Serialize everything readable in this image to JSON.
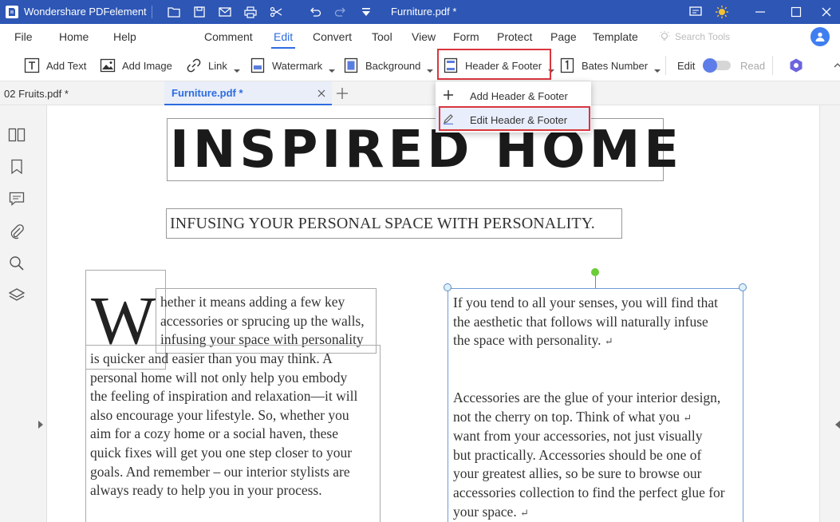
{
  "titlebar": {
    "app_name": "Wondershare PDFelement",
    "document_title": "Furniture.pdf *",
    "bg_color": "#2d56b5"
  },
  "menubar": {
    "items": [
      "File",
      "Home",
      "Help",
      "Comment",
      "Edit",
      "Convert",
      "Tool",
      "View",
      "Form",
      "Protect",
      "Page",
      "Template"
    ],
    "active": "Edit",
    "search_placeholder": "Search Tools"
  },
  "toolbar": {
    "add_text": "Add Text",
    "add_image": "Add Image",
    "link": "Link",
    "watermark": "Watermark",
    "background": "Background",
    "header_footer": "Header & Footer",
    "bates_number": "Bates Number",
    "edit": "Edit",
    "read": "Read"
  },
  "tabs": {
    "items": [
      {
        "label": "02 Fruits.pdf *",
        "active": false
      },
      {
        "label": "Furniture.pdf *",
        "active": true
      }
    ]
  },
  "dropdown": {
    "items": [
      {
        "label": "Add Header & Footer",
        "icon": "plus-icon"
      },
      {
        "label": "Edit Header & Footer",
        "icon": "pencil-icon"
      }
    ]
  },
  "document": {
    "title": "INSPIRED HOME",
    "subtitle": "INFUSING YOUR PERSONAL SPACE WITH PERSONALITY.",
    "dropcap": "W",
    "para1_lines": [
      "hether it means adding a few key",
      "accessories or sprucing up the walls,",
      "infusing your space with personality"
    ],
    "para2_lines": [
      "is quicker and easier than you may think. A",
      "personal home will not only help you embody",
      "the feeling of inspiration and relaxation—it will",
      "also encourage your lifestyle. So, whether you",
      "aim for a cozy home or a social haven, these",
      "quick fixes will get you one step closer to your",
      "goals. And remember – our interior stylists are",
      "always ready to help you in your process."
    ],
    "para3_lines": [
      "If you tend to all your senses, you will find that",
      "the aesthetic that follows will naturally infuse",
      "the space with personality."
    ],
    "para4_lines": [
      "Accessories are the glue of your interior design,",
      "not the cherry on top. Think of what you",
      "want from your accessories, not just visually",
      "but practically. Accessories should be one of",
      "your greatest allies, so be sure to browse our",
      "accessories collection to find the perfect glue for",
      "your space."
    ],
    "return_marks": [
      false,
      false,
      true,
      false,
      true,
      false,
      false,
      false,
      false,
      true
    ]
  }
}
